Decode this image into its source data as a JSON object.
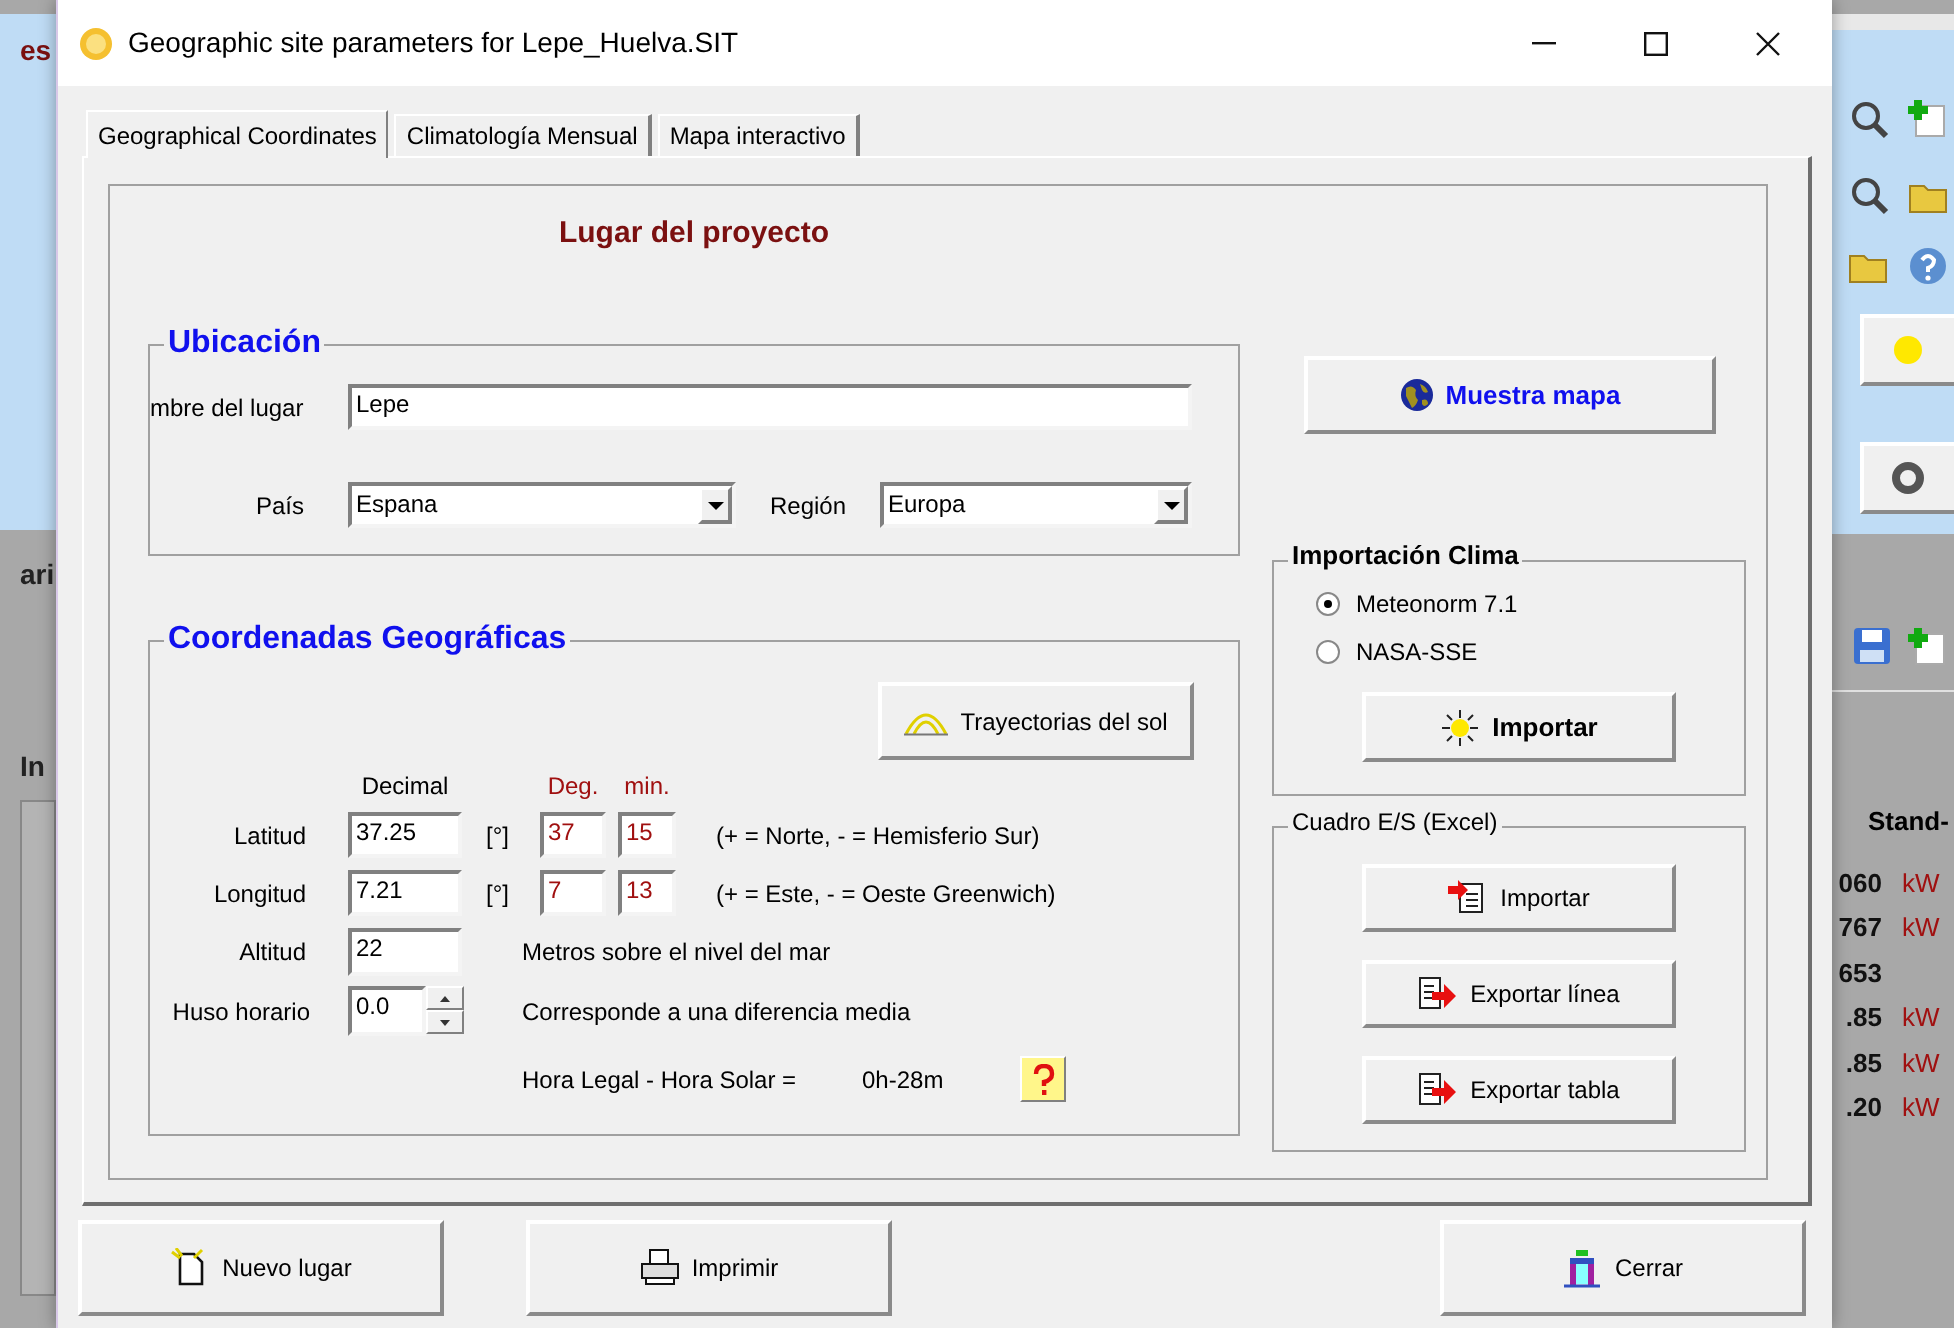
{
  "background": {
    "left_fragments": [
      "es",
      "ari",
      "In"
    ],
    "right": {
      "buttons": [
        {
          "kind": "sun"
        },
        {
          "kind": "gear"
        }
      ],
      "heading": "Stand-",
      "rows": [
        {
          "value": "060",
          "unit": "kW"
        },
        {
          "value": "767",
          "unit": "kW"
        },
        {
          "value": "653"
        },
        {
          "value": ".85",
          "unit": "kW"
        },
        {
          "value": ".85",
          "unit": "kW"
        },
        {
          "value": ".20",
          "unit": "kW"
        }
      ]
    }
  },
  "window": {
    "title": "Geographic site parameters for Lepe_Huelva.SIT"
  },
  "tabs": [
    {
      "label": "Geographical Coordinates",
      "selected": true
    },
    {
      "label": "Climatología Mensual",
      "selected": false
    },
    {
      "label": "Mapa interactivo",
      "selected": false
    }
  ],
  "heading": "Lugar del proyecto",
  "location": {
    "legend": "Ubicación",
    "name_label": "mbre del lugar",
    "name_value": "Lepe",
    "country_label": "País",
    "country": "Espana",
    "region_label": "Región",
    "region": "Europa"
  },
  "show_map_button": "Muestra mapa",
  "climate_import": {
    "legend": "Importación Clima",
    "options": [
      {
        "label": "Meteonorm 7.1",
        "selected": true
      },
      {
        "label": "NASA-SSE",
        "selected": false
      }
    ],
    "button": "Importar"
  },
  "excel": {
    "legend": "Cuadro E/S (Excel)",
    "buttons": [
      {
        "label": "Importar",
        "kind": "import"
      },
      {
        "label": "Exportar línea",
        "kind": "export"
      },
      {
        "label": "Exportar tabla",
        "kind": "export"
      }
    ]
  },
  "coordinates": {
    "legend": "Coordenadas Geográficas",
    "sun_paths_button": "Trayectorias del sol",
    "headers": {
      "decimal": "Decimal",
      "deg": "Deg.",
      "min": "min."
    },
    "rows": [
      {
        "label": "Latitud",
        "decimal": "37.25",
        "unit": "[°]",
        "deg": "37",
        "min": "15",
        "note": "(+ = Norte, - = Hemisferio Sur)"
      },
      {
        "label": "Longitud",
        "decimal": "7.21",
        "unit": "[°]",
        "deg": "7",
        "min": "13",
        "note": "(+ = Este, - = Oeste Greenwich)"
      }
    ],
    "altitude": {
      "label": "Altitud",
      "value": "22",
      "note": "Metros sobre el nivel del mar"
    },
    "timezone": {
      "label": "Huso horario",
      "value": "0.0",
      "note": "Corresponde a una diferencia media"
    },
    "legal_time": {
      "label": "Hora Legal - Hora Solar =",
      "value": "0h-28m"
    }
  },
  "footer_buttons": [
    {
      "label": "Nuevo lugar",
      "kind": "new"
    },
    {
      "label": "Imprimir",
      "kind": "print"
    },
    {
      "label": "Cerrar",
      "kind": "close"
    }
  ]
}
